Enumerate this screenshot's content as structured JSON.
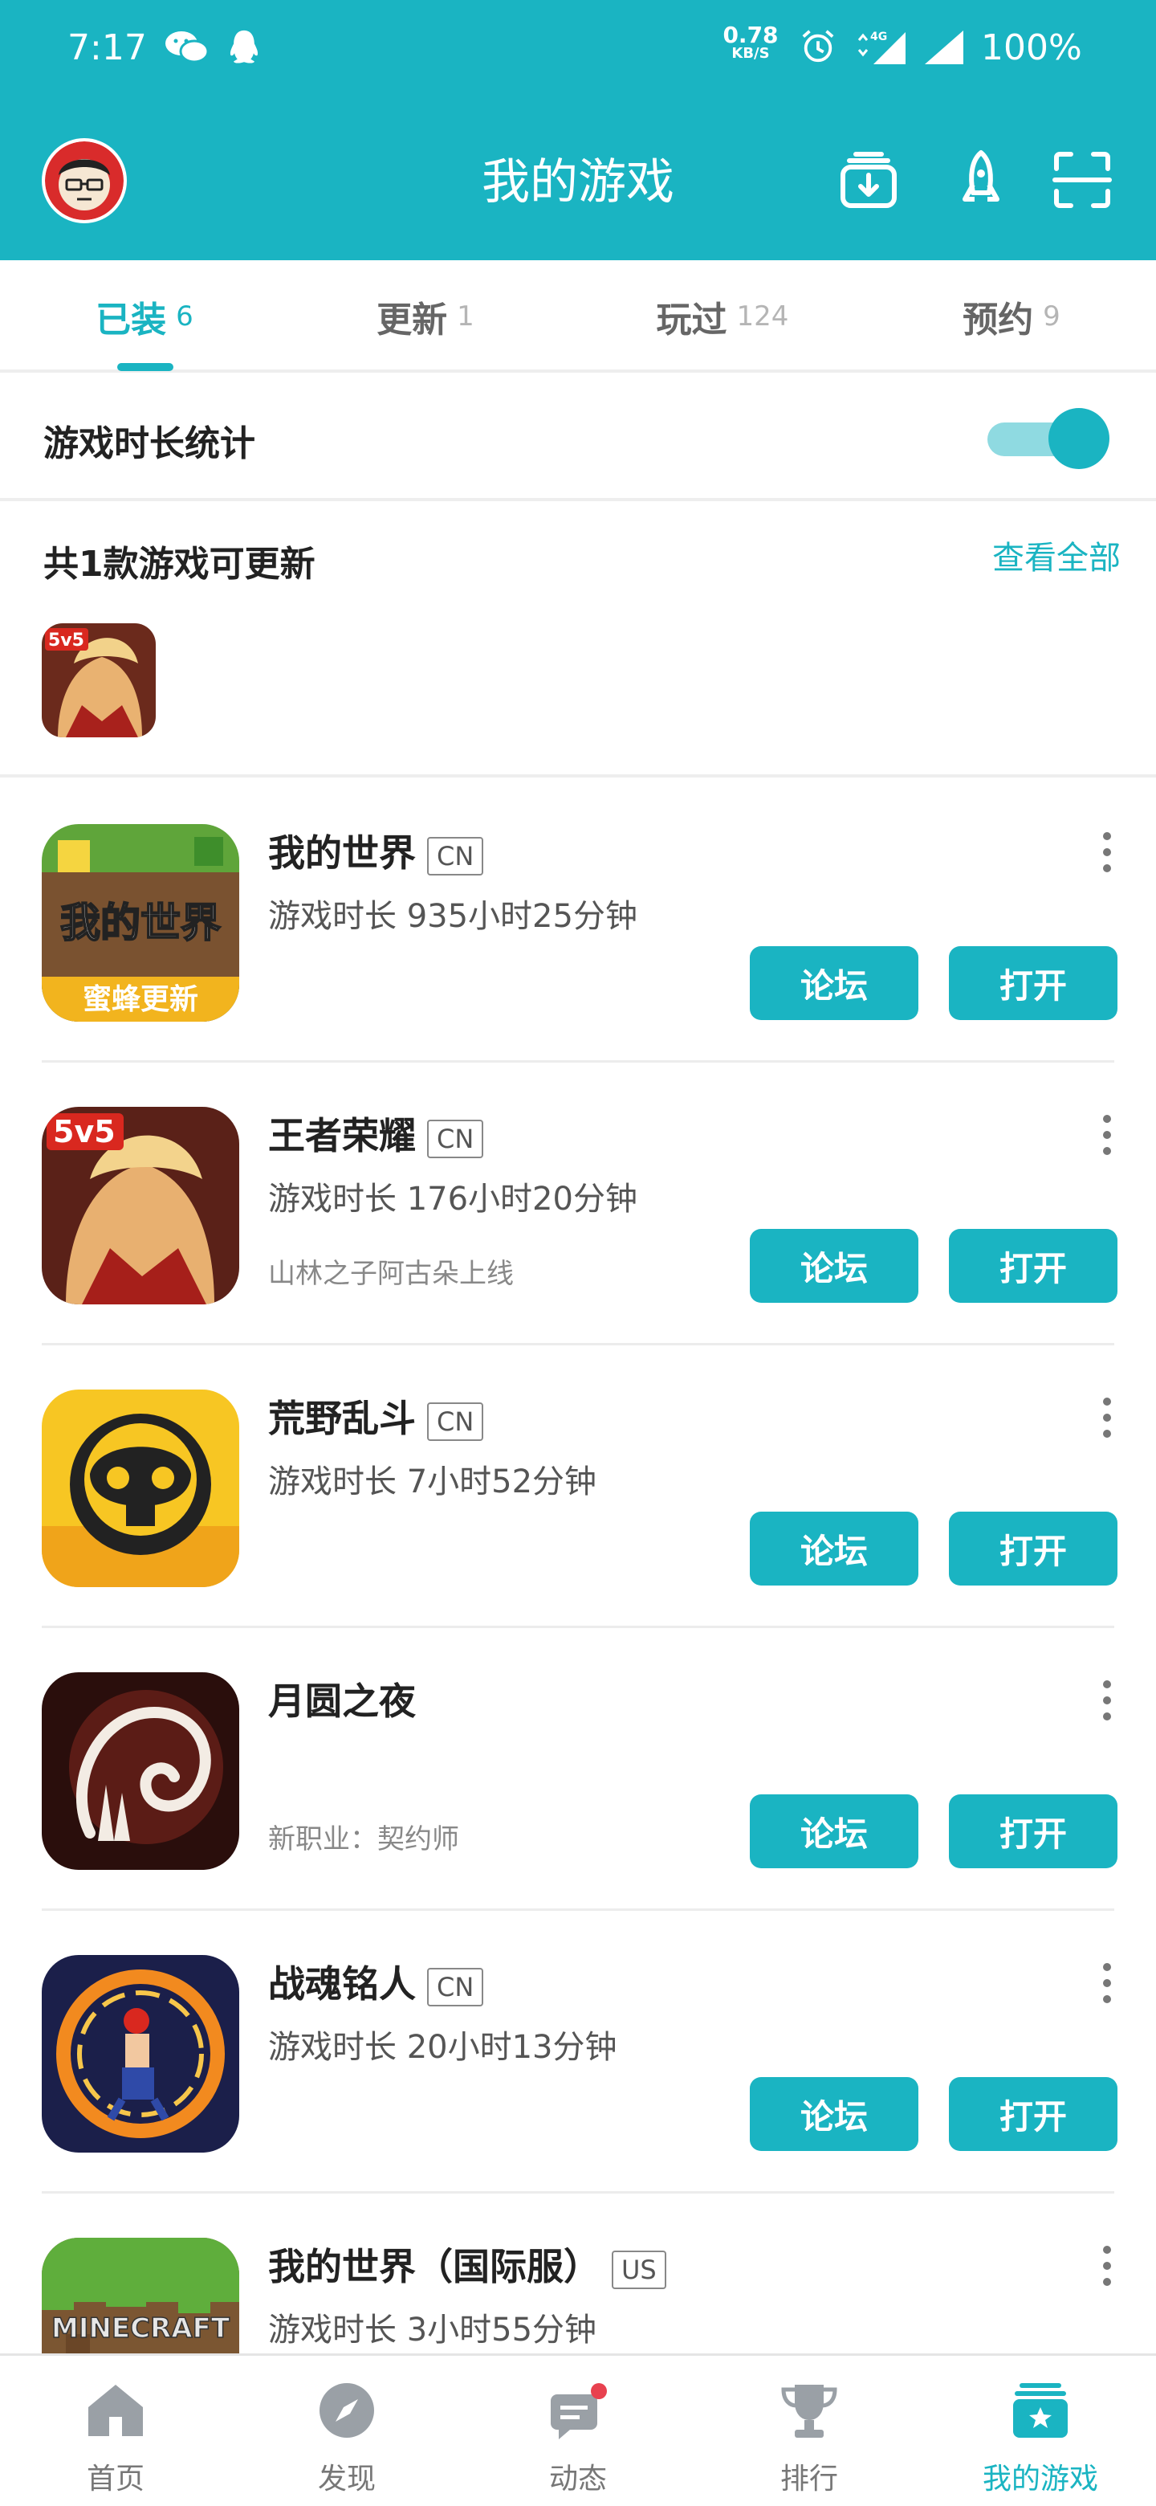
{
  "status_bar": {
    "time": "7:17",
    "net_speed_value": "0.78",
    "net_speed_unit": "KB/S",
    "network": "4G",
    "battery": "100%"
  },
  "header": {
    "title": "我的游戏",
    "icons": [
      "avatar",
      "download-manager-icon",
      "rocket-icon",
      "scan-icon"
    ]
  },
  "tabs": [
    {
      "label": "已装",
      "count": "6",
      "active": true
    },
    {
      "label": "更新",
      "count": "1",
      "active": false
    },
    {
      "label": "玩过",
      "count": "124",
      "active": false
    },
    {
      "label": "预约",
      "count": "9",
      "active": false
    }
  ],
  "stats": {
    "label": "游戏时长统计",
    "enabled": true
  },
  "updates": {
    "label": "共1款游戏可更新",
    "view_all": "查看全部",
    "thumb": "5v5"
  },
  "games": [
    {
      "name": "我的世界",
      "badge": "CN",
      "playtime": "游戏时长 935小时25分钟",
      "note": "",
      "icon_text": "我的世界",
      "icon_sub": "蜜蜂更新"
    },
    {
      "name": "王者荣耀",
      "badge": "CN",
      "playtime": "游戏时长 176小时20分钟",
      "note": "山林之子阿古朵上线",
      "icon_text": "5v5"
    },
    {
      "name": "荒野乱斗",
      "badge": "CN",
      "playtime": "游戏时长 7小时52分钟",
      "note": ""
    },
    {
      "name": "月圆之夜",
      "badge": "",
      "playtime": "",
      "note": "新职业：契约师"
    },
    {
      "name": "战魂铭人",
      "badge": "CN",
      "playtime": "游戏时长 20小时13分钟",
      "note": ""
    },
    {
      "name": "我的世界（国际服）",
      "badge": "US",
      "playtime": "游戏时长 3小时55分钟",
      "note": "",
      "icon_text": "MINECRAFT"
    }
  ],
  "buttons": {
    "forum": "论坛",
    "open": "打开"
  },
  "bottom_nav": [
    {
      "label": "首页",
      "icon": "home-icon",
      "active": false
    },
    {
      "label": "发现",
      "icon": "compass-icon",
      "active": false
    },
    {
      "label": "动态",
      "icon": "chat-icon",
      "active": false,
      "dot": true
    },
    {
      "label": "排行",
      "icon": "trophy-icon",
      "active": false
    },
    {
      "label": "我的游戏",
      "icon": "my-games-icon",
      "active": true
    }
  ],
  "colors": {
    "accent": "#1ab4c2",
    "accent_light": "#8fdae1",
    "notification_dot": "#e8414f"
  }
}
